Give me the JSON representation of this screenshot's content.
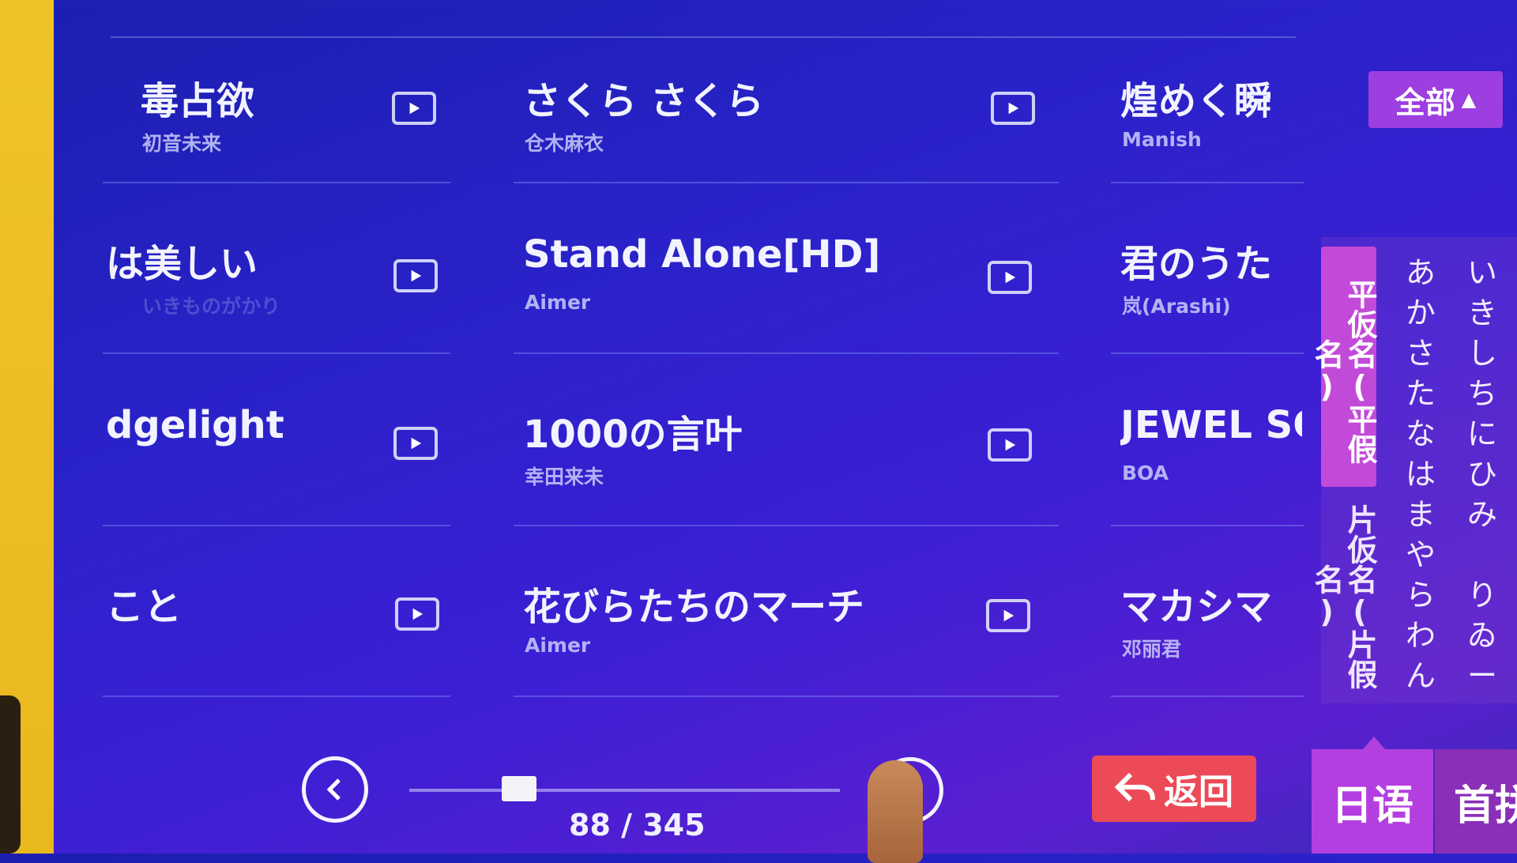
{
  "songs": [
    {
      "title": "毒占欲",
      "artist": "初音未来"
    },
    {
      "title": "さくら さくら",
      "artist": "仓木麻衣"
    },
    {
      "title": "煌めく瞬",
      "artist": "Manish"
    },
    {
      "title": "は美しい",
      "artist": "いきものがかり"
    },
    {
      "title": "Stand Alone[HD]",
      "artist": "Aimer"
    },
    {
      "title": "君のうた",
      "artist": "岚(Arashi)"
    },
    {
      "title": "dgelight",
      "artist": ""
    },
    {
      "title": "1000の言叶",
      "artist": "幸田来未"
    },
    {
      "title": "JEWEL SO",
      "artist": "BOA"
    },
    {
      "title": "こと",
      "artist": ""
    },
    {
      "title": "花びらたちのマーチ",
      "artist": "Aimer"
    },
    {
      "title": "マカシマ",
      "artist": "邓丽君"
    }
  ],
  "filter": {
    "label": "全部"
  },
  "kana": {
    "hiragana_tab": "平仮名(平假名)",
    "katakana_tab": "片仮名(片假名)",
    "col1": [
      "あ",
      "か",
      "さ",
      "た",
      "な",
      "は",
      "ま",
      "や",
      "ら",
      "わ",
      "ん"
    ],
    "col2": [
      "い",
      "き",
      "し",
      "ち",
      "に",
      "ひ",
      "み",
      "",
      "り",
      "ゐ",
      "ー"
    ]
  },
  "pagination": {
    "current": 88,
    "total": 345,
    "text": "88 / 345",
    "position": 0.255
  },
  "buttons": {
    "return_label": "返回",
    "language_label": "日语",
    "home_label": "首拼"
  },
  "colors": {
    "accent": "#9c3ee0",
    "return": "#ec4a57",
    "background": "#2a22c9"
  }
}
